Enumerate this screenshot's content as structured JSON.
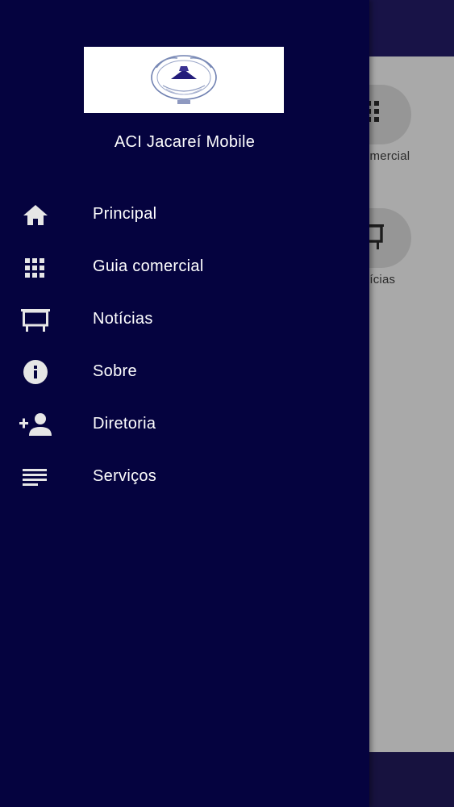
{
  "drawer": {
    "logo_icon": "aci-jacarei-logo",
    "app_name": "ACI Jacareí Mobile",
    "items": [
      {
        "label": "Principal",
        "icon": "home-icon"
      },
      {
        "label": "Guia comercial",
        "icon": "grid-icon"
      },
      {
        "label": "Notícias",
        "icon": "easel-icon"
      },
      {
        "label": "Sobre",
        "icon": "info-icon"
      },
      {
        "label": "Diretoria",
        "icon": "person-add-icon"
      },
      {
        "label": "Serviços",
        "icon": "list-icon"
      }
    ]
  },
  "background": {
    "tiles": [
      {
        "label": "omercial",
        "icon": "grid-icon"
      },
      {
        "label": "tícias",
        "icon": "easel-icon"
      }
    ]
  },
  "colors": {
    "drawer_bg": "#05033f",
    "topbar": "#181347",
    "icon_color": "#e6e6e6"
  }
}
